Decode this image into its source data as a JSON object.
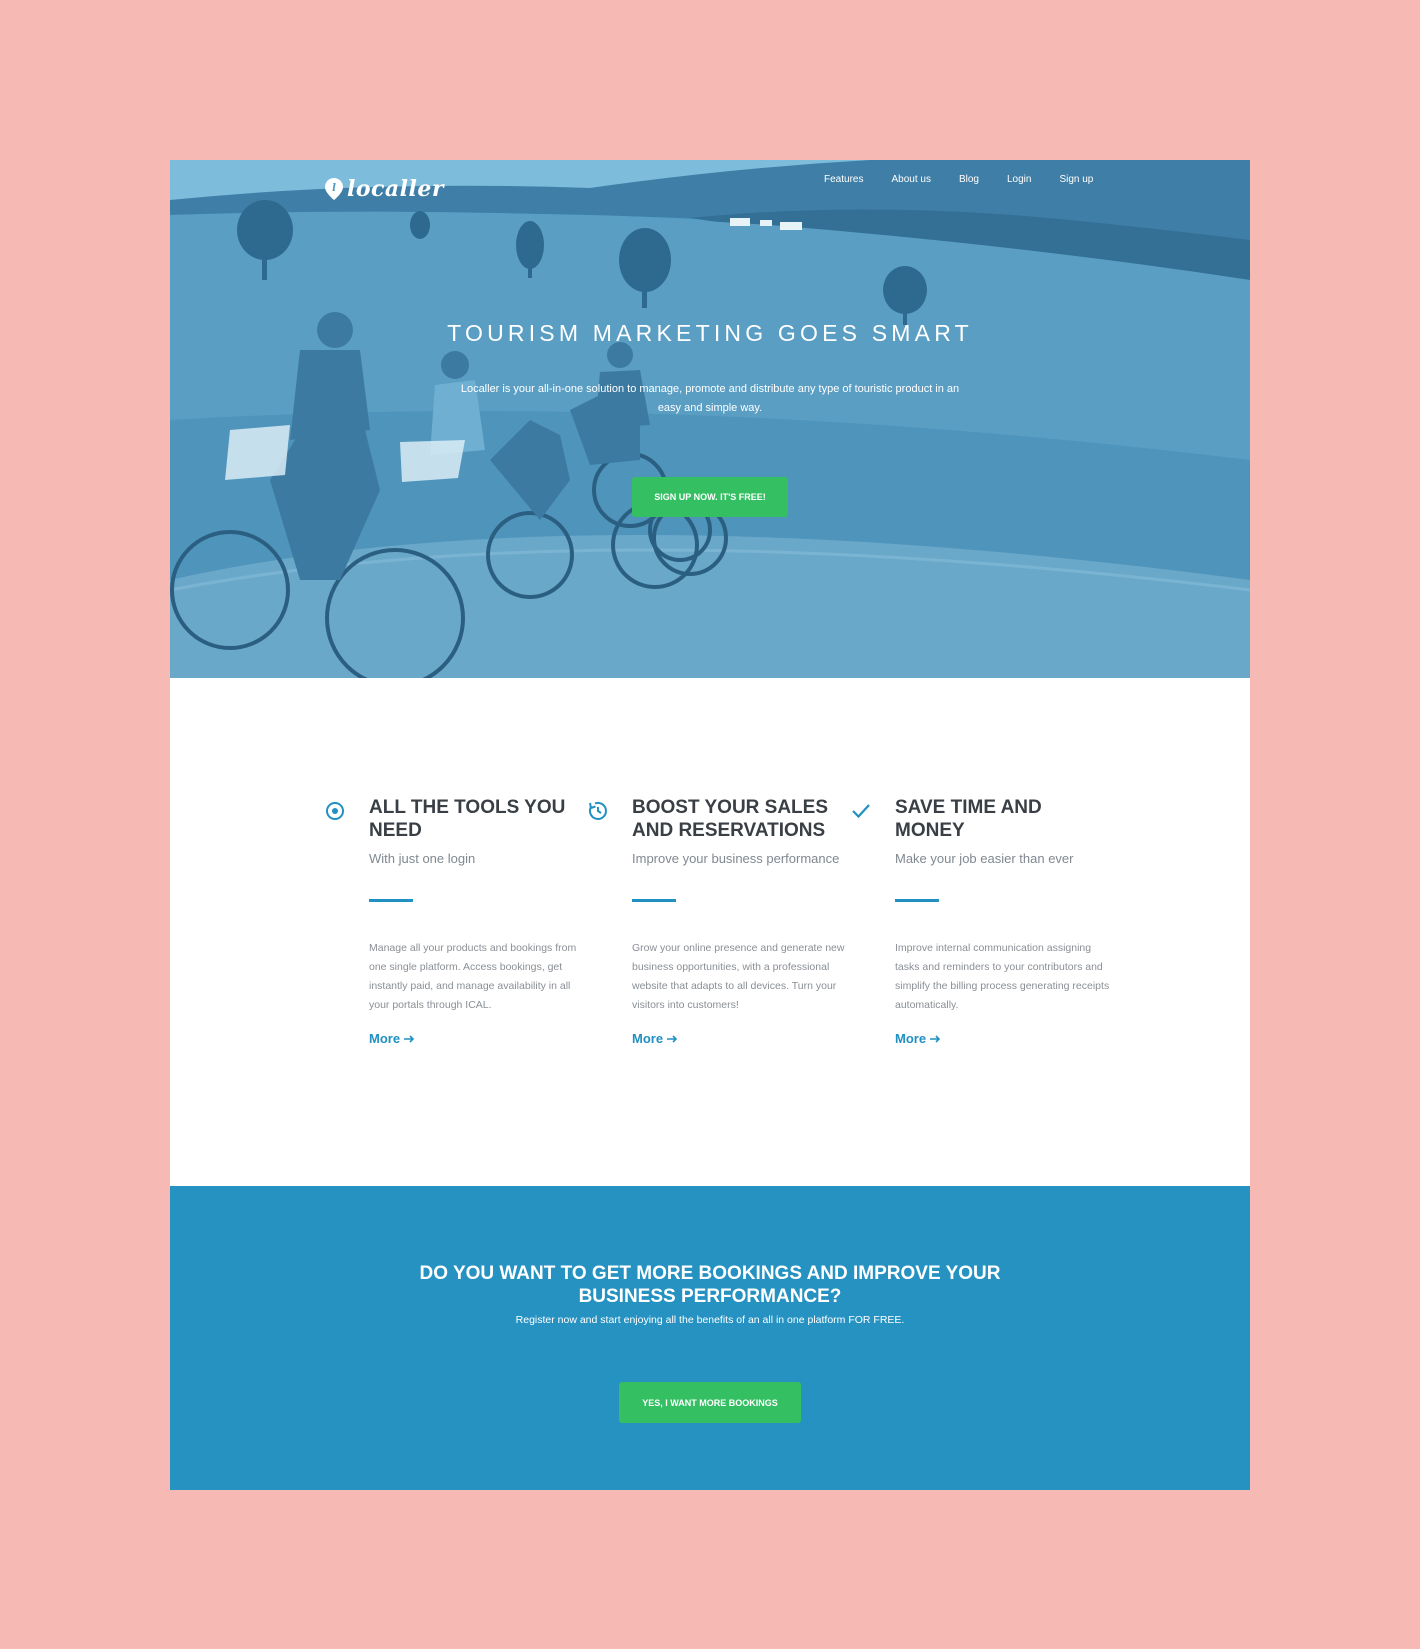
{
  "brand": {
    "name": "localler",
    "logo_letter": "l"
  },
  "nav": {
    "items": [
      "Features",
      "About us",
      "Blog",
      "Login",
      "Sign up"
    ]
  },
  "hero": {
    "title": "TOURISM MARKETING GOES SMART",
    "subtitle": "Localler is your all-in-one solution to manage, promote and distribute any type of touristic product in an easy and simple way.",
    "cta_label": "SIGN UP NOW. IT'S FREE!"
  },
  "features": [
    {
      "icon": "target-icon",
      "title": "ALL THE TOOLS YOU NEED",
      "tagline": "With just one login",
      "description": "Manage all your products and bookings from one single platform. Access bookings, get instantly paid, and manage availability in all your portals through ICAL.",
      "more_label": "More"
    },
    {
      "icon": "refresh-clock-icon",
      "title": "BOOST YOUR SALES AND RESERVATIONS",
      "tagline": "Improve your business performance",
      "description": "Grow your online presence and generate new business opportunities, with a professional website that adapts to all devices. Turn your visitors into customers!",
      "more_label": "More"
    },
    {
      "icon": "checkmark-icon",
      "title": "SAVE TIME AND MONEY",
      "tagline": "Make your job easier than ever",
      "description": "Improve internal communication assigning tasks and reminders to your contributors and simplify the billing process generating receipts automatically.",
      "more_label": "More"
    }
  ],
  "cta": {
    "title": "DO YOU WANT TO GET MORE BOOKINGS AND IMPROVE YOUR BUSINESS PERFORMANCE?",
    "subtitle": "Register now and start enjoying all the benefits of an all in one platform FOR FREE.",
    "button_label": "YES, I WANT MORE BOOKINGS"
  },
  "colors": {
    "background": "#f7b9b4",
    "accent_blue": "#2592c2",
    "button_green": "#35bf63",
    "hero_tint": "#5aa3c8",
    "heading": "#3a3f45"
  }
}
